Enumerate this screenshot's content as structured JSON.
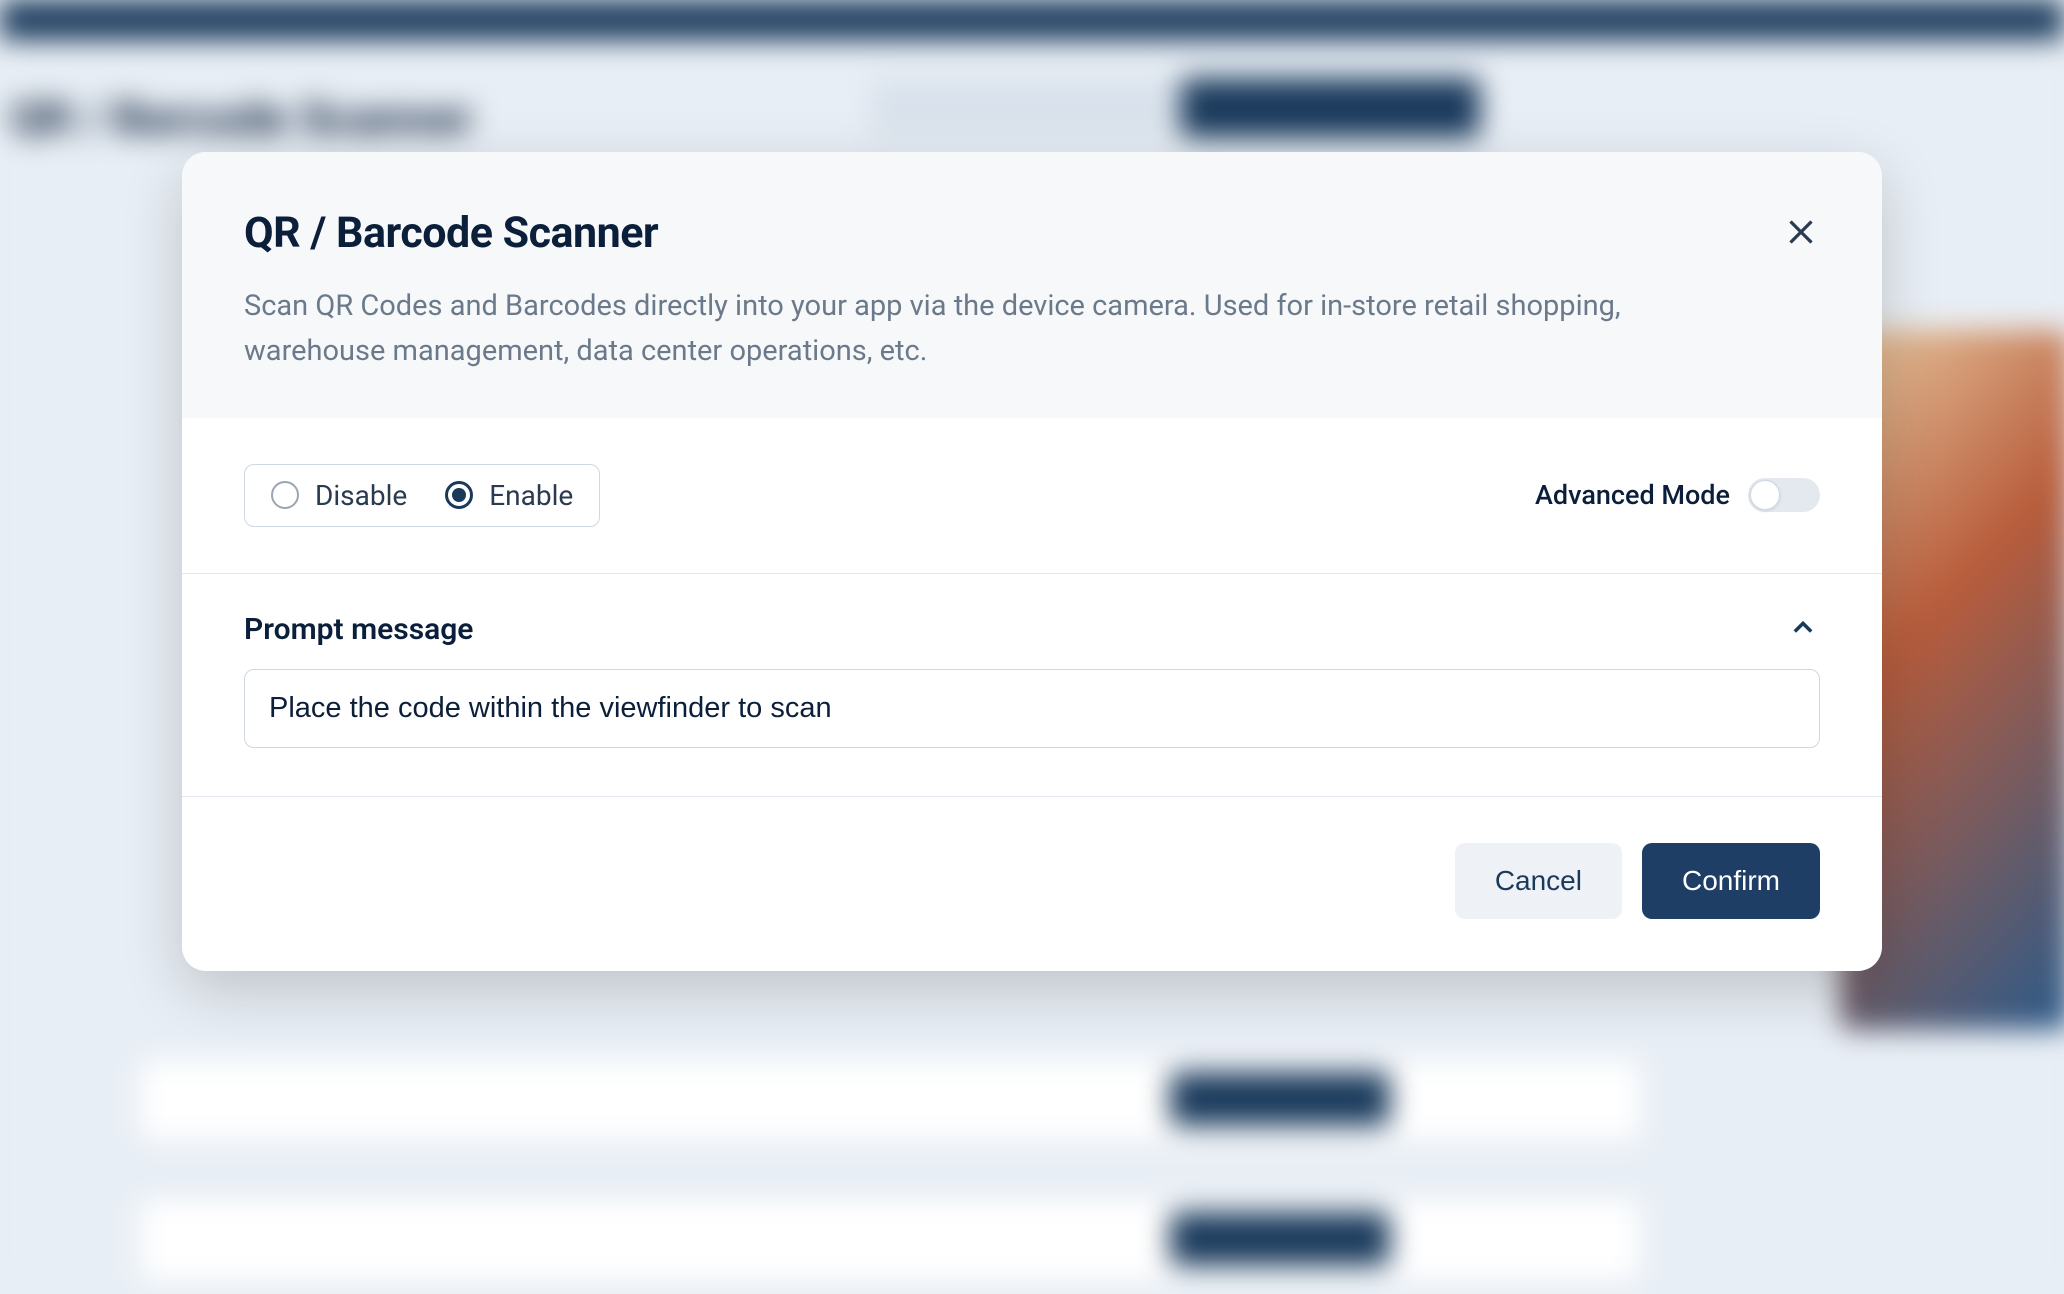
{
  "modal": {
    "title": "QR / Barcode Scanner",
    "description": "Scan QR Codes and Barcodes directly into your app via the device camera. Used for in-store retail shopping, warehouse management, data center operations, etc."
  },
  "controls": {
    "disable_label": "Disable",
    "enable_label": "Enable",
    "selected": "enable",
    "advanced_mode_label": "Advanced Mode",
    "advanced_mode_on": false
  },
  "prompt_section": {
    "title": "Prompt message",
    "value": "Place the code within the viewfinder to scan"
  },
  "footer": {
    "cancel_label": "Cancel",
    "confirm_label": "Confirm"
  }
}
